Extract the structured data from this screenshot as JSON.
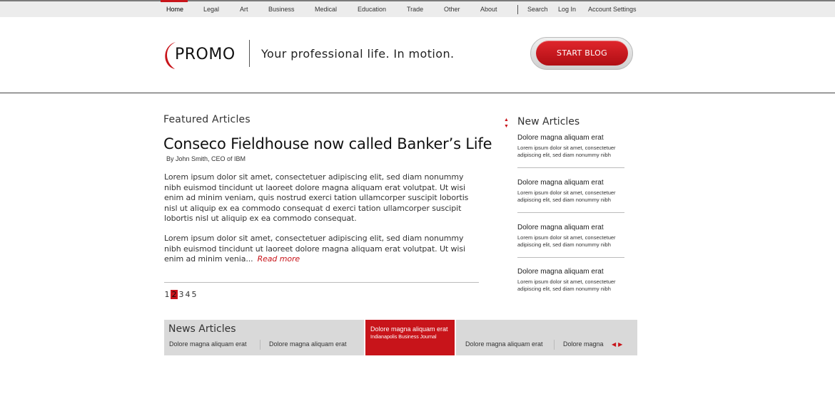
{
  "nav": {
    "items": [
      {
        "label": "Home",
        "active": true
      },
      {
        "label": "Legal"
      },
      {
        "label": "Art"
      },
      {
        "label": "Business"
      },
      {
        "label": "Medical"
      },
      {
        "label": "Education"
      },
      {
        "label": "Trade"
      },
      {
        "label": "Other"
      },
      {
        "label": "About"
      }
    ],
    "utility": [
      {
        "label": "Search"
      },
      {
        "label": "Log In"
      },
      {
        "label": "Account Settings"
      }
    ]
  },
  "header": {
    "logo_text": "PROMO",
    "tagline": "Your professional life. In motion.",
    "cta_label": "START BLOG"
  },
  "featured": {
    "heading": "Featured Articles",
    "title": "Conseco Fieldhouse now called Banker’s Life",
    "byline": "By John Smith, CEO of IBM",
    "paragraph1": "Lorem ipsum dolor sit amet, consectetuer adipiscing elit, sed diam nonummy nibh euismod tincidunt ut laoreet dolore magna aliquam erat volutpat. Ut wisi enim ad minim veniam, quis nostrud exerci tation ullamcorper suscipit lobortis nisl ut aliquip ex ea commodo consequat d exerci tation ullamcorper suscipit lobortis nisl ut aliquip ex ea commodo consequat.",
    "paragraph2": "Lorem ipsum dolor sit amet, consectetuer adipiscing elit, sed diam nonummy nibh euismod tincidunt ut laoreet dolore magna aliquam erat volutpat. Ut wisi enim ad minim venia...",
    "read_more": "Read more",
    "pages": [
      "1",
      "2",
      "3",
      "4",
      "5"
    ],
    "current_page": "2"
  },
  "new_articles": {
    "heading": "New Articles",
    "items": [
      {
        "title": "Dolore magna aliquam erat",
        "text": "Lorem ipsum dolor sit amet, consectetuer adipiscing elit, sed diam nonummy nibh"
      },
      {
        "title": "Dolore magna aliquam erat",
        "text": "Lorem ipsum dolor sit amet, consectetuer adipiscing elit, sed diam nonummy nibh"
      },
      {
        "title": "Dolore magna aliquam erat",
        "text": "Lorem ipsum dolor sit amet, consectetuer adipiscing elit, sed diam nonummy nibh"
      },
      {
        "title": "Dolore magna aliquam erat",
        "text": "Lorem ipsum dolor sit amet, consectetuer adipiscing elit, sed diam nonummy nibh"
      }
    ]
  },
  "news": {
    "heading": "News Articles",
    "items": [
      "Dolore magna aliquam erat",
      "Dolore magna aliquam erat",
      "Dolore magna aliquam erat",
      "Dolore magna"
    ],
    "highlight": {
      "title": "Dolore magna aliquam erat",
      "source": "Indianapolis Business Journal"
    }
  },
  "colors": {
    "accent": "#c8141a",
    "nav_bg": "#ececec",
    "news_bg": "#d9d9d9"
  },
  "icons": {
    "up_arrow": "triangle-up-icon",
    "down_arrow": "triangle-down-icon",
    "prev_arrow": "triangle-left-icon",
    "next_arrow": "triangle-right-icon"
  }
}
